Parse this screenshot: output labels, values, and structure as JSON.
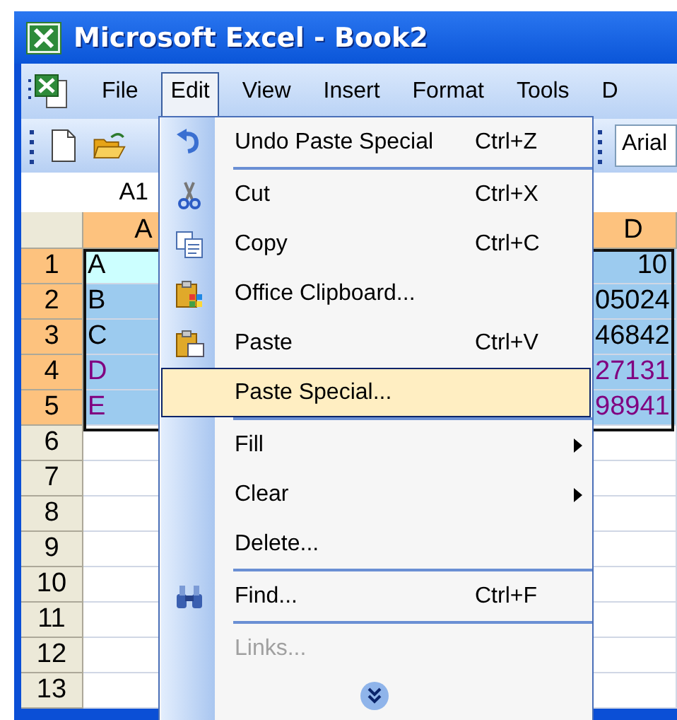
{
  "window": {
    "title": "Microsoft Excel - Book2"
  },
  "menu_bar": {
    "items": [
      {
        "label": "File",
        "selected": false
      },
      {
        "label": "Edit",
        "selected": true
      },
      {
        "label": "View",
        "selected": false
      },
      {
        "label": "Insert",
        "selected": false
      },
      {
        "label": "Format",
        "selected": false
      },
      {
        "label": "Tools",
        "selected": false
      },
      {
        "label": "D",
        "selected": false
      }
    ]
  },
  "toolbar": {
    "font_box": "Arial"
  },
  "formula_bar": {
    "name_box": "A1"
  },
  "grid": {
    "columns": [
      {
        "label": "A",
        "selected": true
      },
      {
        "label": "D",
        "selected": true
      }
    ],
    "rows": [
      {
        "label": "1",
        "selected": true,
        "cells": [
          {
            "text": "A",
            "color": "#000000",
            "active": true
          },
          {
            "text": "10",
            "color": "#000000",
            "active": false
          }
        ]
      },
      {
        "label": "2",
        "selected": true,
        "cells": [
          {
            "text": "B",
            "color": "#000000",
            "active": false
          },
          {
            "text": "05024",
            "color": "#000000",
            "active": false
          }
        ]
      },
      {
        "label": "3",
        "selected": true,
        "cells": [
          {
            "text": "C",
            "color": "#000000",
            "active": false
          },
          {
            "text": "46842",
            "color": "#000000",
            "active": false
          }
        ]
      },
      {
        "label": "4",
        "selected": true,
        "cells": [
          {
            "text": "D",
            "color": "#800080",
            "active": false
          },
          {
            "text": "27131",
            "color": "#800080",
            "active": false
          }
        ]
      },
      {
        "label": "5",
        "selected": true,
        "cells": [
          {
            "text": "E",
            "color": "#800080",
            "active": false
          },
          {
            "text": "98941",
            "color": "#800080",
            "active": false
          }
        ]
      },
      {
        "label": "6",
        "selected": false,
        "cells": []
      },
      {
        "label": "7",
        "selected": false,
        "cells": []
      },
      {
        "label": "8",
        "selected": false,
        "cells": []
      },
      {
        "label": "9",
        "selected": false,
        "cells": []
      },
      {
        "label": "10",
        "selected": false,
        "cells": []
      },
      {
        "label": "11",
        "selected": false,
        "cells": []
      },
      {
        "label": "12",
        "selected": false,
        "cells": []
      },
      {
        "label": "13",
        "selected": false,
        "cells": []
      }
    ]
  },
  "edit_menu": {
    "items": [
      {
        "kind": "item",
        "label": "Undo Paste Special",
        "shortcut": "Ctrl+Z",
        "submenu": false,
        "selected": false,
        "disabled": false
      },
      {
        "kind": "separator"
      },
      {
        "kind": "item",
        "label": "Cut",
        "shortcut": "Ctrl+X",
        "submenu": false,
        "selected": false,
        "disabled": false
      },
      {
        "kind": "item",
        "label": "Copy",
        "shortcut": "Ctrl+C",
        "submenu": false,
        "selected": false,
        "disabled": false
      },
      {
        "kind": "item",
        "label": "Office Clipboard...",
        "submenu": false,
        "selected": false,
        "disabled": false
      },
      {
        "kind": "item",
        "label": "Paste",
        "shortcut": "Ctrl+V",
        "submenu": false,
        "selected": false,
        "disabled": false
      },
      {
        "kind": "item",
        "label": "Paste Special...",
        "submenu": false,
        "selected": true,
        "disabled": false
      },
      {
        "kind": "separator"
      },
      {
        "kind": "item",
        "label": "Fill",
        "submenu": true,
        "selected": false,
        "disabled": false
      },
      {
        "kind": "item",
        "label": "Clear",
        "submenu": true,
        "selected": false,
        "disabled": false
      },
      {
        "kind": "item",
        "label": "Delete...",
        "submenu": false,
        "selected": false,
        "disabled": false
      },
      {
        "kind": "separator"
      },
      {
        "kind": "item",
        "label": "Find...",
        "shortcut": "Ctrl+F",
        "submenu": false,
        "selected": false,
        "disabled": false
      },
      {
        "kind": "separator"
      },
      {
        "kind": "item",
        "label": "Links...",
        "submenu": false,
        "selected": false,
        "disabled": true
      },
      {
        "kind": "expand"
      }
    ]
  }
}
